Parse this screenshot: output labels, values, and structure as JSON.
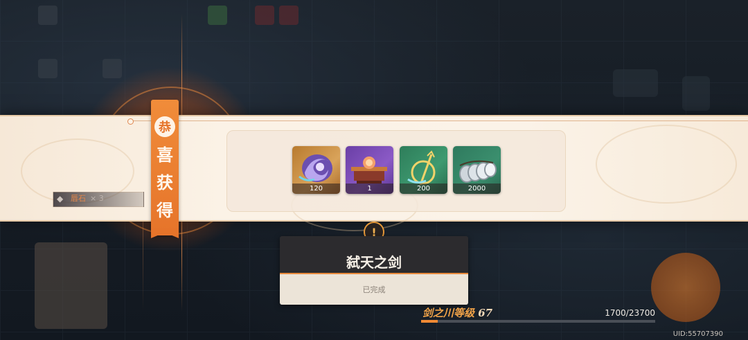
{
  "banner": {
    "title_chars": [
      "恭",
      "喜",
      "获",
      "得"
    ]
  },
  "rewards": [
    {
      "name": "spirit-orb",
      "quantity": "120",
      "rarity_color": "#c98f3e"
    },
    {
      "name": "treasure-chest",
      "quantity": "1",
      "rarity_color": "#7b4cb8"
    },
    {
      "name": "trident-relic",
      "quantity": "200",
      "rarity_color": "#3a8e68"
    },
    {
      "name": "silver-coins",
      "quantity": "2000",
      "rarity_color": "#338566"
    }
  ],
  "side_chip": {
    "label": "唇石",
    "count": "× 3"
  },
  "quest": {
    "title": "弑天之剑",
    "status": "已完成",
    "alert_symbol": "!"
  },
  "level": {
    "label": "剑之川等级",
    "value": "67",
    "xp_text": "1700/23700",
    "xp_fraction": 0.0717
  },
  "uid": "UID:55707390",
  "colors": {
    "accent": "#e6742a",
    "banner_bg": "#fbf2e6",
    "xp_fill": "#f08a34"
  }
}
